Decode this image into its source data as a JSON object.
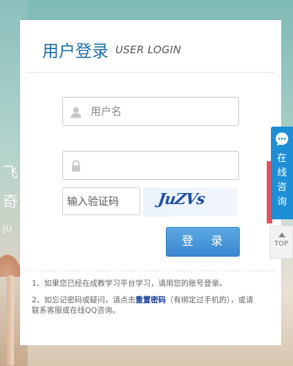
{
  "background": {
    "char1": "飞",
    "char2": "奇",
    "partial_text": "JU"
  },
  "header": {
    "title_cn": "用户登录",
    "title_en": "USER LOGIN"
  },
  "form": {
    "username_placeholder": "用户名",
    "password_placeholder": "",
    "captcha_placeholder": "输入验证码",
    "captcha_text": "JuZVs",
    "submit_label": "登 录"
  },
  "notes": {
    "line1": "1、如果您已经在成教学习平台学习，请用您的账号登录。",
    "line2_prefix": "2、如忘记密码或疑问，请点击",
    "line2_link": "重置密码",
    "line2_suffix": "（有绑定过手机的），或请联系客服或在线QQ咨询。"
  },
  "side": {
    "consult_label": "在线咨询",
    "top_label": "TOP"
  },
  "colors": {
    "accent": "#1e6ea8",
    "button": "#3b86cf",
    "consult": "#1e8fd6",
    "link": "#1a3e9c"
  },
  "icons": [
    "user-icon",
    "lock-icon",
    "chat-bubble-icon",
    "arrow-up-icon"
  ]
}
